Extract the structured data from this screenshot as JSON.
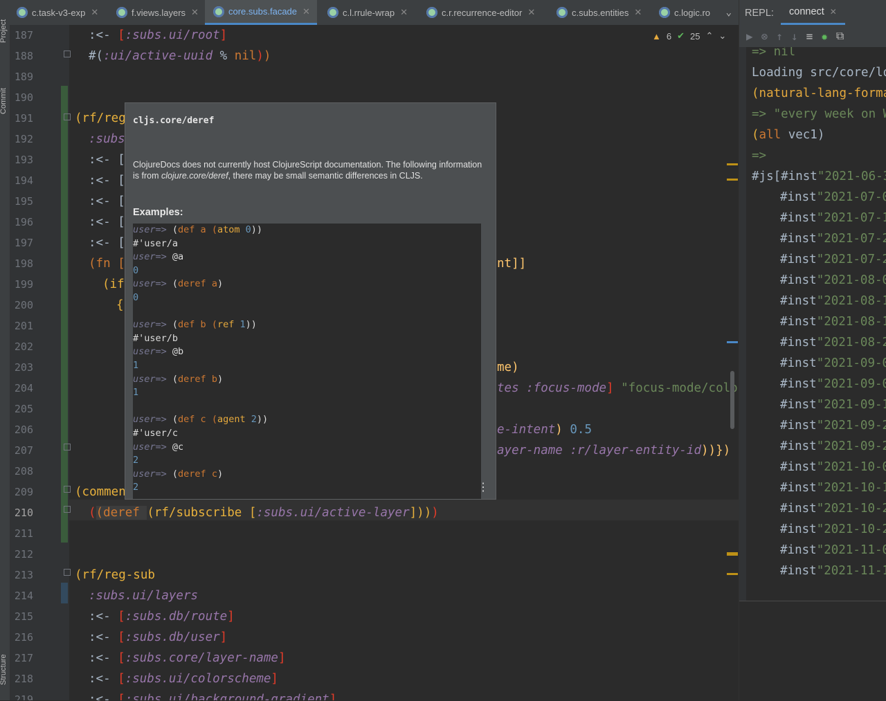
{
  "side_labels": {
    "project": "Project",
    "commit": "Commit",
    "structure": "Structure"
  },
  "tabs": [
    {
      "label": "c.task-v3-exp"
    },
    {
      "label": "f.views.layers"
    },
    {
      "label": "core.subs.facade"
    },
    {
      "label": "c.l.rrule-wrap"
    },
    {
      "label": "c.r.recurrence-editor"
    },
    {
      "label": "c.subs.entities"
    },
    {
      "label": "c.logic.ro"
    }
  ],
  "inspections": {
    "warnings": "6",
    "ok": "25"
  },
  "line_numbers": [
    "187",
    "188",
    "189",
    "190",
    "191",
    "192",
    "193",
    "194",
    "195",
    "196",
    "197",
    "198",
    "199",
    "200",
    "201",
    "202",
    "203",
    "204",
    "205",
    "206",
    "207",
    "208",
    "209",
    "210",
    "211",
    "212",
    "213",
    "214",
    "215",
    "216",
    "217",
    "218",
    "219"
  ],
  "current_line": "210",
  "code": {
    "l187_arrow": ":<- ",
    "l187_kw": ":subs.ui/root",
    "l188_a": "#(",
    "l188_kw": ":ui/active-uuid",
    "l188_b": " % ",
    "l188_nil": "nil",
    "l191": "(rf/reg",
    "l192": ":subs",
    "l193": ":<- [",
    "l194": ":<- [",
    "l195": ":<- [",
    "l196": ":<- [",
    "l197": ":<- [",
    "l198_a": "(fn [",
    "l198_b": "nt]]",
    "l199": "(if",
    "l200": "{",
    "l203": "me)",
    "l204_a": "tes :focus-mode",
    "l204_b": "] ",
    "l204_c": "\"focus-mode/color",
    "l206_a": "e-intent",
    "l206_b": ") ",
    "l206_c": "0.5",
    "l207_a": "ayer-name :r/layer-entity-id",
    "l207_b": "))})",
    "l209": "(commen",
    "l210_a": "(deref ",
    "l210_b": "(rf/subscribe [",
    "l210_kw": ":subs.ui/active-layer",
    "l213": "(rf/reg-sub",
    "l214": ":subs.ui/layers",
    "l215": ":subs.db/route",
    "l216": ":subs.db/user",
    "l217": ":subs.core/layer-name",
    "l218": ":subs.ui/colorscheme",
    "l219": ":subs.ui/background-gradient",
    "arrow": ":<- "
  },
  "doc_popup": {
    "title": "cljs.core/deref",
    "desc_a": "ClojureDocs does not currently host ClojureScript documentation. The following information is from ",
    "desc_em": "clojure.core/deref",
    "desc_b": ", there may be small semantic differences in CLJS.",
    "examples_label": "Examples:",
    "prompt": "user=> ",
    "ex": {
      "a1": "def a (",
      "a1f": "atom",
      "a1n": "0",
      "a1r": "#'user/a",
      "a2": "@a",
      "a2r": "0",
      "a3": "deref a",
      "a3r": "0",
      "b1": "def b (",
      "b1f": "ref",
      "b1n": "1",
      "b1r": "#'user/b",
      "b2": "@b",
      "b2r": "1",
      "b3": "deref b",
      "b3r": "1",
      "c1": "def c (",
      "c1f": "agent",
      "c1n": "2",
      "c1r": "#'user/c",
      "c2": "@c",
      "c2r": "2",
      "c3": "deref c",
      "c3r": "2"
    }
  },
  "repl": {
    "label": "REPL:",
    "tab": "connect",
    "lines": {
      "nil": "=> nil",
      "loading": "Loading src/core/lo",
      "nl_fn": "natural-lang-forma",
      "every_arrow": "=> ",
      "every": "\"every week on W",
      "all_fn": "all",
      "all_arg": " vec1)",
      "empty_arrow": "=>",
      "js_a": "#js[#inst",
      "js_b": "\"2021-06-3"
    },
    "insts": [
      "\"2021-07-0",
      "\"2021-07-1",
      "\"2021-07-2",
      "\"2021-07-2",
      "\"2021-08-0",
      "\"2021-08-1",
      "\"2021-08-1",
      "\"2021-08-2",
      "\"2021-09-0",
      "\"2021-09-0",
      "\"2021-09-1",
      "\"2021-09-2",
      "\"2021-09-2",
      "\"2021-10-0",
      "\"2021-10-1",
      "\"2021-10-2",
      "\"2021-10-2",
      "\"2021-11-0",
      "\"2021-11-1"
    ],
    "inst_tag": "#inst"
  }
}
